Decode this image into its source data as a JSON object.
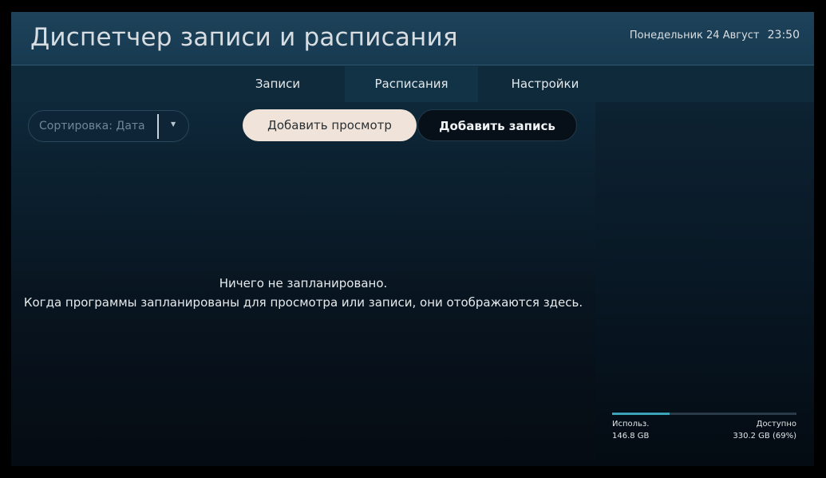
{
  "header": {
    "title": "Диспетчер записи и расписания",
    "date": "Понедельник 24 Август",
    "time": "23:50"
  },
  "tabs": [
    {
      "label": "Записи",
      "active": false
    },
    {
      "label": "Расписания",
      "active": true
    },
    {
      "label": "Настройки",
      "active": false
    }
  ],
  "toolbar": {
    "sort_label": "Сортировка: Дата",
    "add_view_label": "Добавить просмотр",
    "add_record_label": "Добавить запись"
  },
  "empty_state": {
    "title": "Ничего не запланировано.",
    "subtitle": "Когда программы запланированы для просмотра или записи, они отображаются здесь."
  },
  "storage": {
    "used_label": "Использ.",
    "used_value": "146.8 GB",
    "free_label": "Доступно",
    "free_value": "330.2 GB (69%)",
    "used_fraction": 0.31
  },
  "colors": {
    "accent": "#3aa3b6",
    "button_primary": "#efe3da",
    "header": "#173a51"
  }
}
